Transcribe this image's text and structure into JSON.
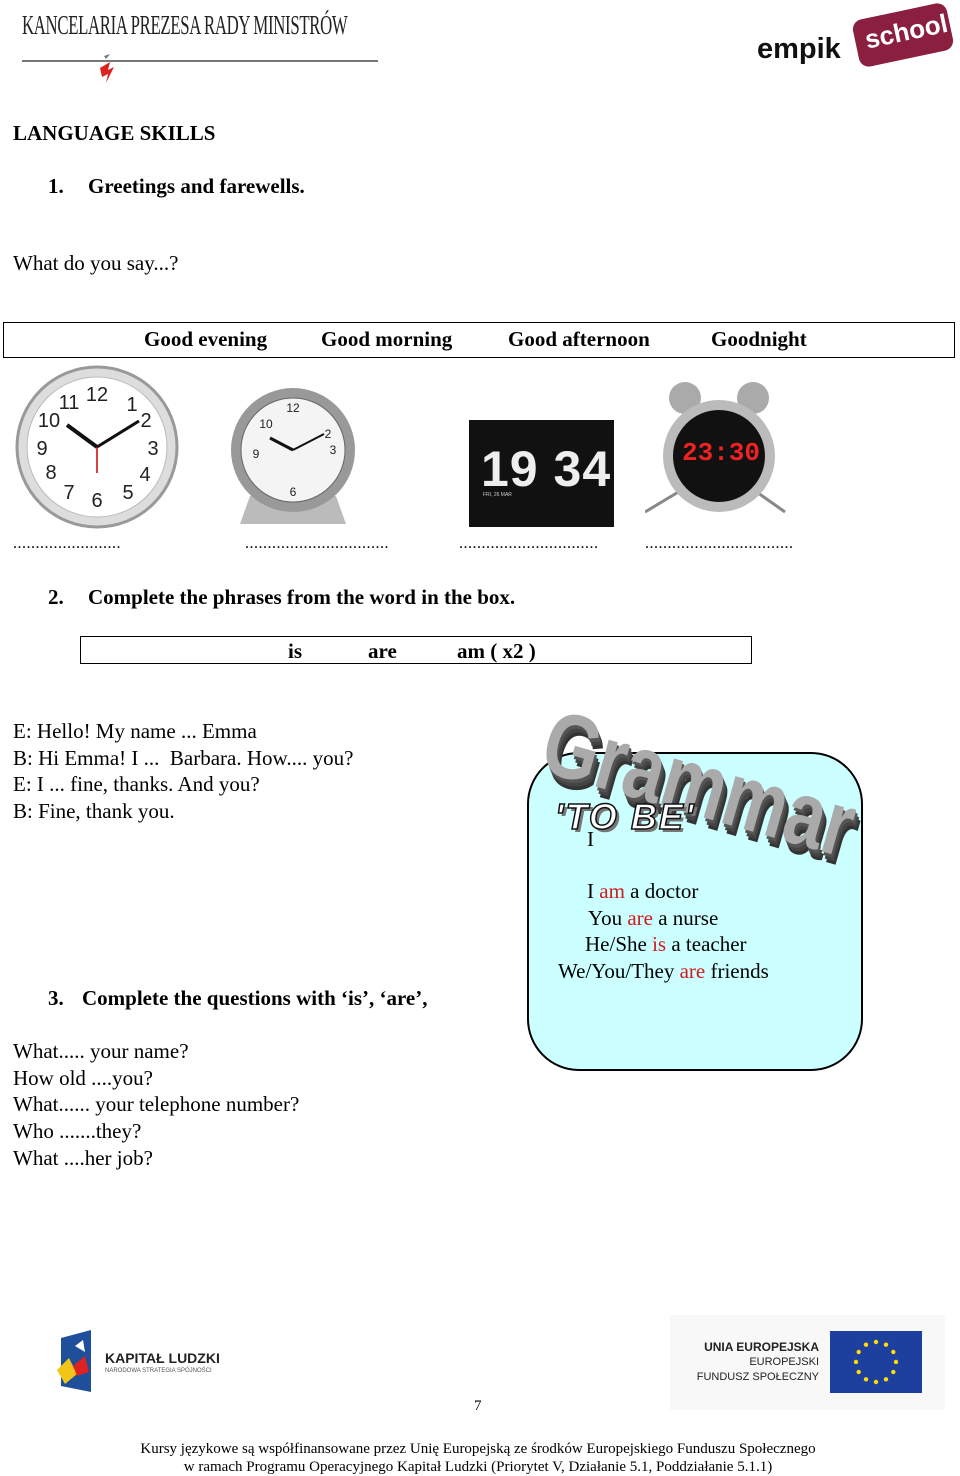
{
  "header": {
    "left_logo_text": "KANCELARIA PREZESA RADY MINISTRÓW",
    "right_logo_text": {
      "brand": "empik",
      "sub": "school"
    }
  },
  "section_title": "LANGUAGE SKILLS",
  "exercise1": {
    "number": "1.",
    "title": "Greetings and farewells.",
    "prompt": "What do you say...?",
    "options": [
      "Good evening",
      "Good morning",
      "Good afternoon",
      "Goodnight"
    ],
    "clocks": [
      {
        "type": "wall-clock",
        "blank": "........................"
      },
      {
        "type": "desk-clock",
        "blank": "................................"
      },
      {
        "type": "digital-clock",
        "display": "19 34",
        "date": "FRI, 26 MAR",
        "blank": "..............................."
      },
      {
        "type": "alarm-clock",
        "display": "23:30",
        "blank": "................................."
      }
    ]
  },
  "exercise2": {
    "number": "2.",
    "title": "Complete the phrases from the word in the box.",
    "words": [
      "is",
      "are",
      "am ( x2 )"
    ],
    "dialogue": [
      "E: Hello! My name ... Emma",
      "B: Hi Emma! I ...  Barbara. How.... you?",
      "E: I ... fine, thanks. And you?",
      "B: Fine, thank you."
    ]
  },
  "grammar_box": {
    "heading": "Grammar",
    "subheading": "'TO BE'",
    "stray": "I",
    "lines": [
      {
        "pre": "I ",
        "verb": "am",
        "post": " a doctor"
      },
      {
        "pre": "You ",
        "verb": "are",
        "post": " a nurse"
      },
      {
        "pre": "He/She ",
        "verb": "is",
        "post": " a teacher"
      },
      {
        "pre": "We/You/They ",
        "verb": "are",
        "post": " friends"
      }
    ],
    "colors": {
      "background": "#ccffff",
      "verb": "#d11a1a"
    }
  },
  "exercise3": {
    "number": "3.",
    "title": "Complete the questions with ‘is’, ‘are’,",
    "questions": [
      "What..... your name?",
      "How old ....you?",
      "What...... your telephone number?",
      "Who .......they?",
      "What ....her job?"
    ]
  },
  "footer": {
    "left_logo": {
      "title": "KAPITAŁ LUDZKI",
      "subtitle": "NARODOWA STRATEGIA SPÓJNOŚCI"
    },
    "right_logo": {
      "line1": "UNIA EUROPEJSKA",
      "line2": "EUROPEJSKI",
      "line3": "FUNDUSZ SPOŁECZNY"
    },
    "page_number": "7",
    "note_line1": "Kursy językowe są współfinansowane przez Unię Europejską ze środków Europejskiego Funduszu Społecznego",
    "note_line2": "w ramach Programu Operacyjnego Kapitał Ludzki (Priorytet V, Działanie 5.1, Poddziałanie 5.1.1)"
  }
}
